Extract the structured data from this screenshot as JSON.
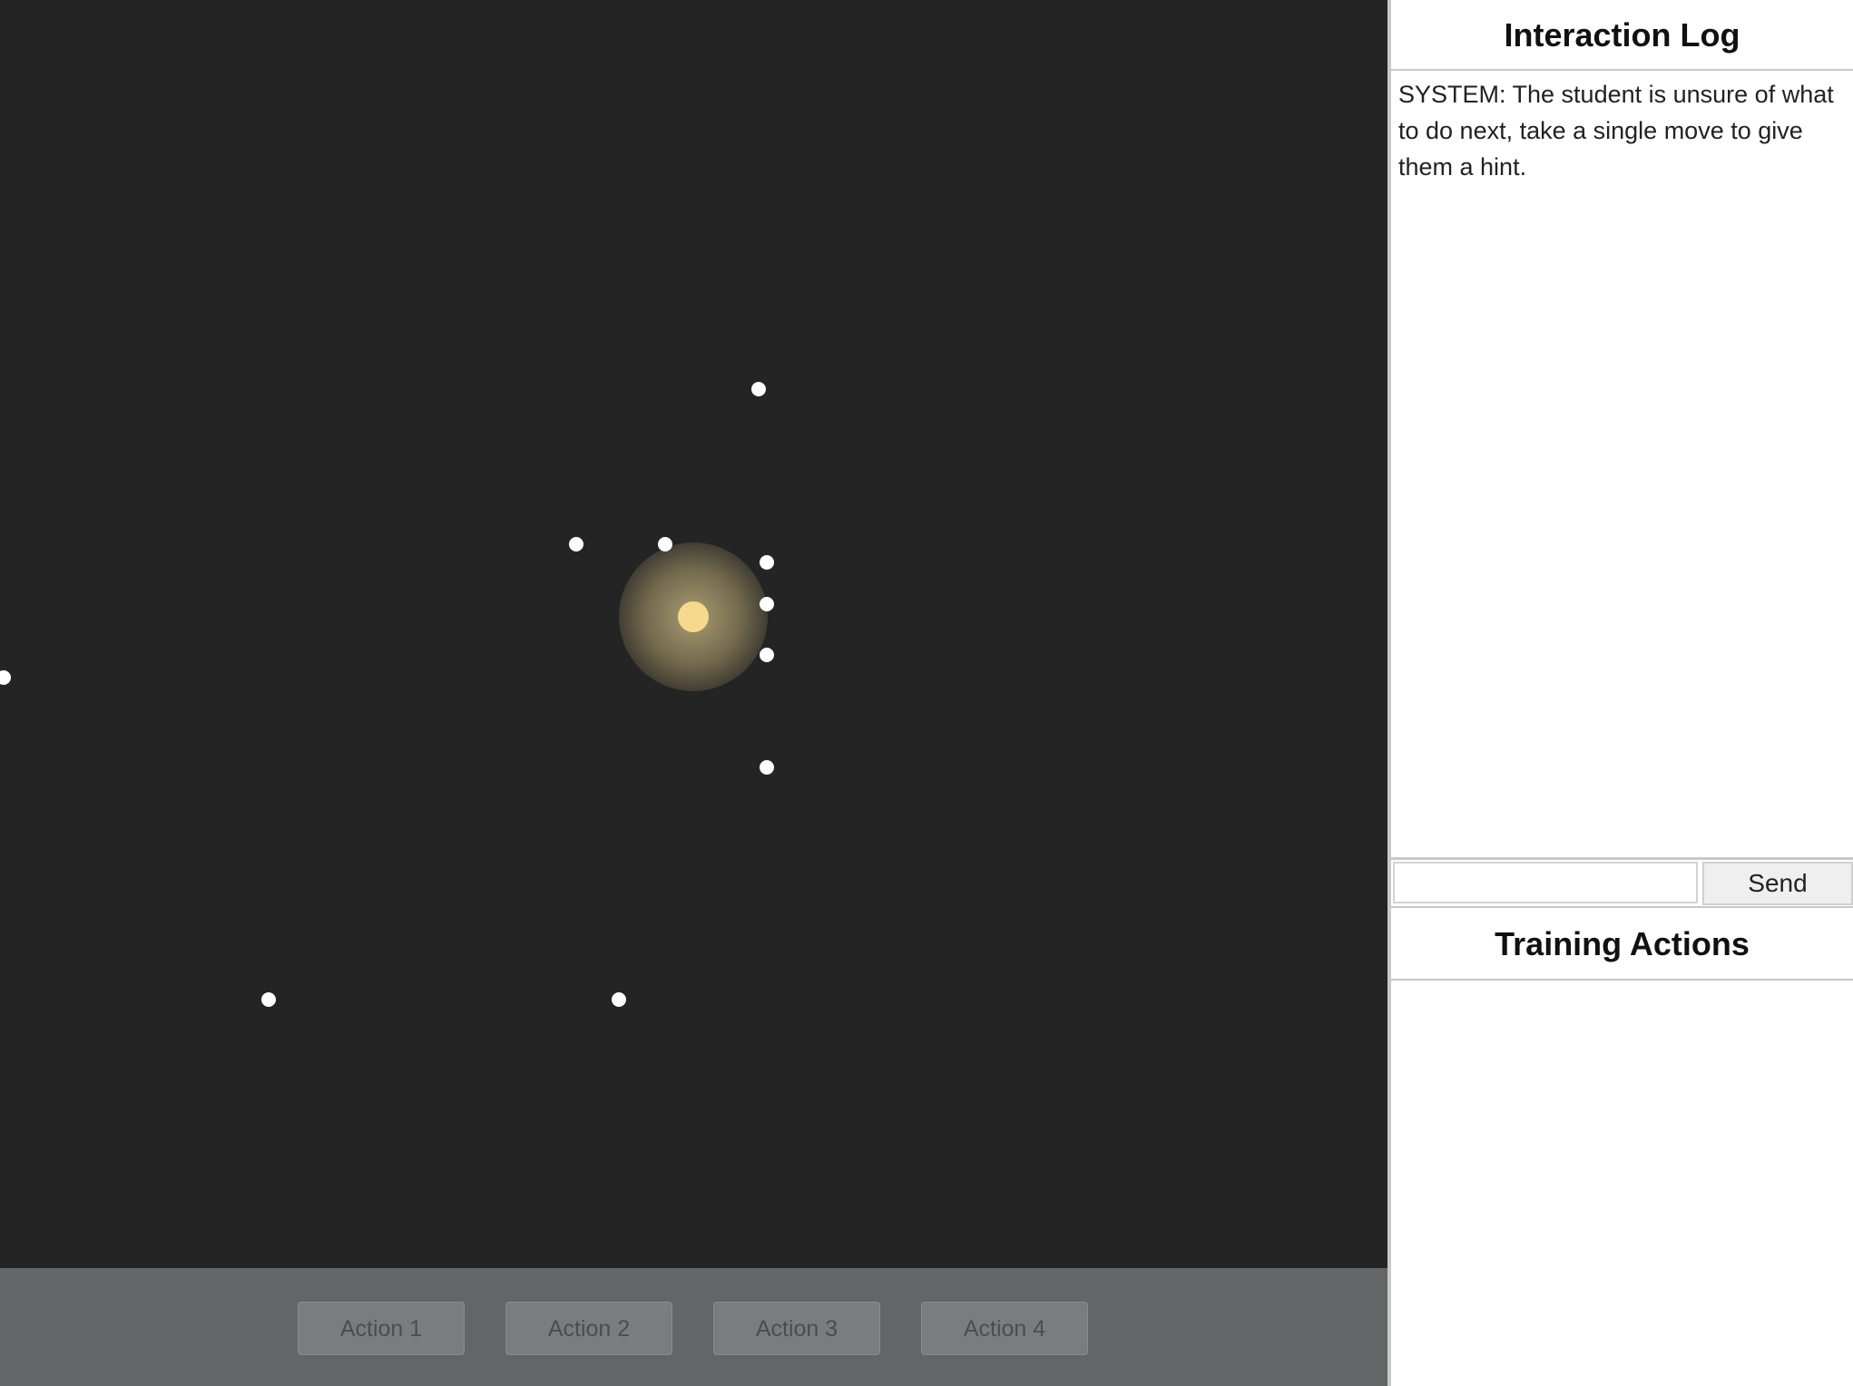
{
  "interaction_log": {
    "title": "Interaction Log",
    "messages": [
      "SYSTEM: The student is unsure of what to do next, take a single move to give them a hint."
    ]
  },
  "chat": {
    "input_value": "",
    "send_label": "Send"
  },
  "training_actions": {
    "title": "Training Actions"
  },
  "action_bar": {
    "buttons": [
      "Action 1",
      "Action 2",
      "Action 3",
      "Action 4"
    ]
  },
  "colors": {
    "game_background": "#242424",
    "action_bar": "#646566",
    "light_core": "#f6d98c",
    "particle": "#ffffff"
  },
  "icons": {
    "light_source": "glowing-light-icon",
    "particle": "white-dot-icon"
  }
}
